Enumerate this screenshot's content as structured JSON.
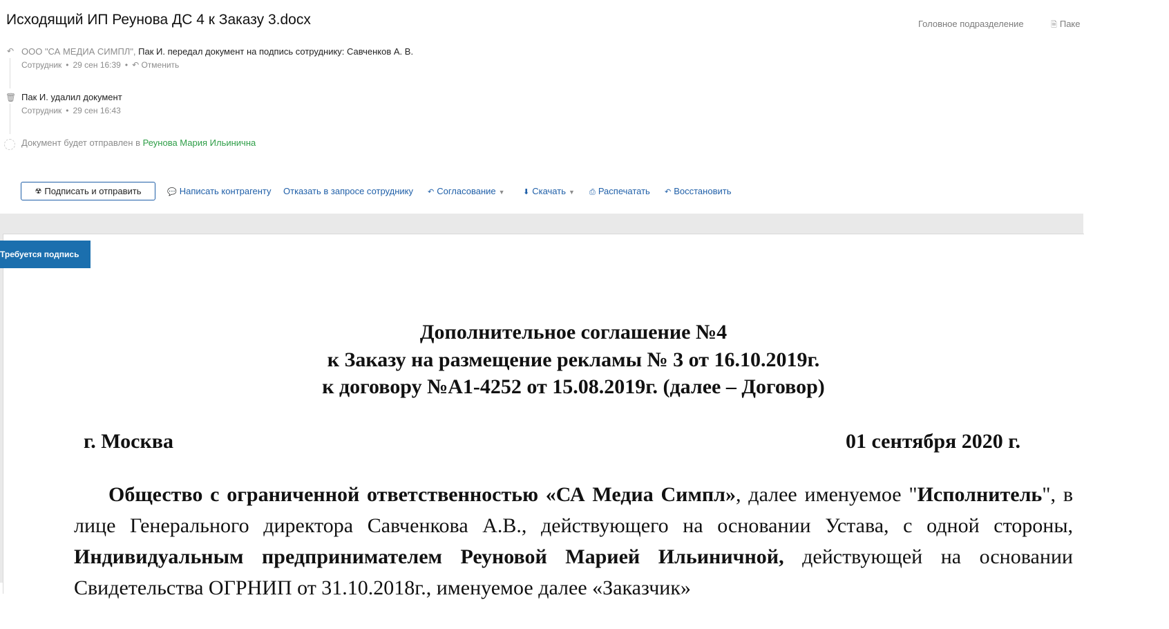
{
  "header": {
    "title": "Исходящий ИП Реунова ДС 4 к Заказу 3.docx",
    "org_unit": "Головное подразделение",
    "package": "Паке"
  },
  "events": [
    {
      "icon": "reply-arrow-icon",
      "actor": "ООО \"СА МЕДИА СИМПЛ\",",
      "text": " Пак И. передал документ на подпись сотруднику: Савченков А. В.",
      "role": "Сотрудник",
      "time": "29 сен 16:39",
      "action": "Отменить"
    },
    {
      "icon": "trash-icon",
      "text": "Пак И. удалил документ",
      "role": "Сотрудник",
      "time": "29 сен 16:43"
    }
  ],
  "pending": {
    "prefix": "Документ будет отправлен в",
    "recipient": "Реунова Мария Ильинична"
  },
  "toolbar": {
    "sign_send": "Подписать и отправить",
    "write": "Написать контрагенту",
    "refuse": "Отказать в запросе сотруднику",
    "approval": "Согласование",
    "download": "Скачать",
    "print": "Распечатать",
    "restore": "Восстановить"
  },
  "badge": "Требуется подпись",
  "document": {
    "title_lines": [
      "Дополнительное соглашение №4",
      "к Заказу на размещение рекламы № 3 от 16.10.2019г.",
      "к договору №А1-4252 от 15.08.2019г. (далее – Договор)"
    ],
    "city": "г. Москва",
    "date": "01 сентября 2020 г.",
    "para": {
      "org_bold": "Общество с ограниченной ответственностью «СА Медиа Симпл»",
      "t1": ", далее именуемое \"",
      "executor_bold": "Исполнитель",
      "t2": "\", в лице Генерального директора Савченкова А.В., действующего на основании Устава, с одной стороны, ",
      "ip_bold": "Индивидуальным предпринимателем Реуновой Марией Ильиничной,",
      "t3": " действующей на основании Свидетельства ОГРНИП от 31.10.2018г., именуемое далее «Заказчик»"
    }
  }
}
